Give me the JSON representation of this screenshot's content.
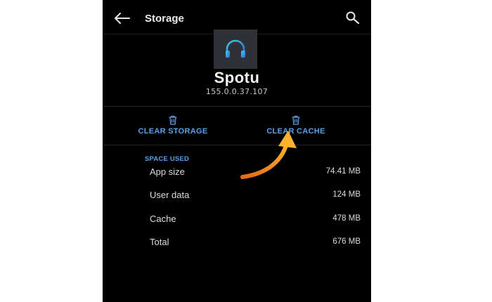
{
  "header": {
    "title": "Storage",
    "back_icon": "back-arrow-icon",
    "search_icon": "search-icon"
  },
  "app": {
    "name": "Spotu",
    "version": "155.0.0.37.107",
    "icon": "headphones-icon"
  },
  "actions": {
    "clear_storage_label": "CLEAR STORAGE",
    "clear_cache_label": "CLEAR CACHE",
    "icon": "trash-icon"
  },
  "space_used": {
    "header": "SPACE USED",
    "rows": [
      {
        "label": "App size",
        "value": "74.41 MB"
      },
      {
        "label": "User data",
        "value": "124 MB"
      },
      {
        "label": "Cache",
        "value": "478 MB"
      },
      {
        "label": "Total",
        "value": "676 MB"
      }
    ]
  },
  "colors": {
    "background": "#000000",
    "accent": "#5aa0e8",
    "annotation_arrow": "#f7a21b"
  }
}
